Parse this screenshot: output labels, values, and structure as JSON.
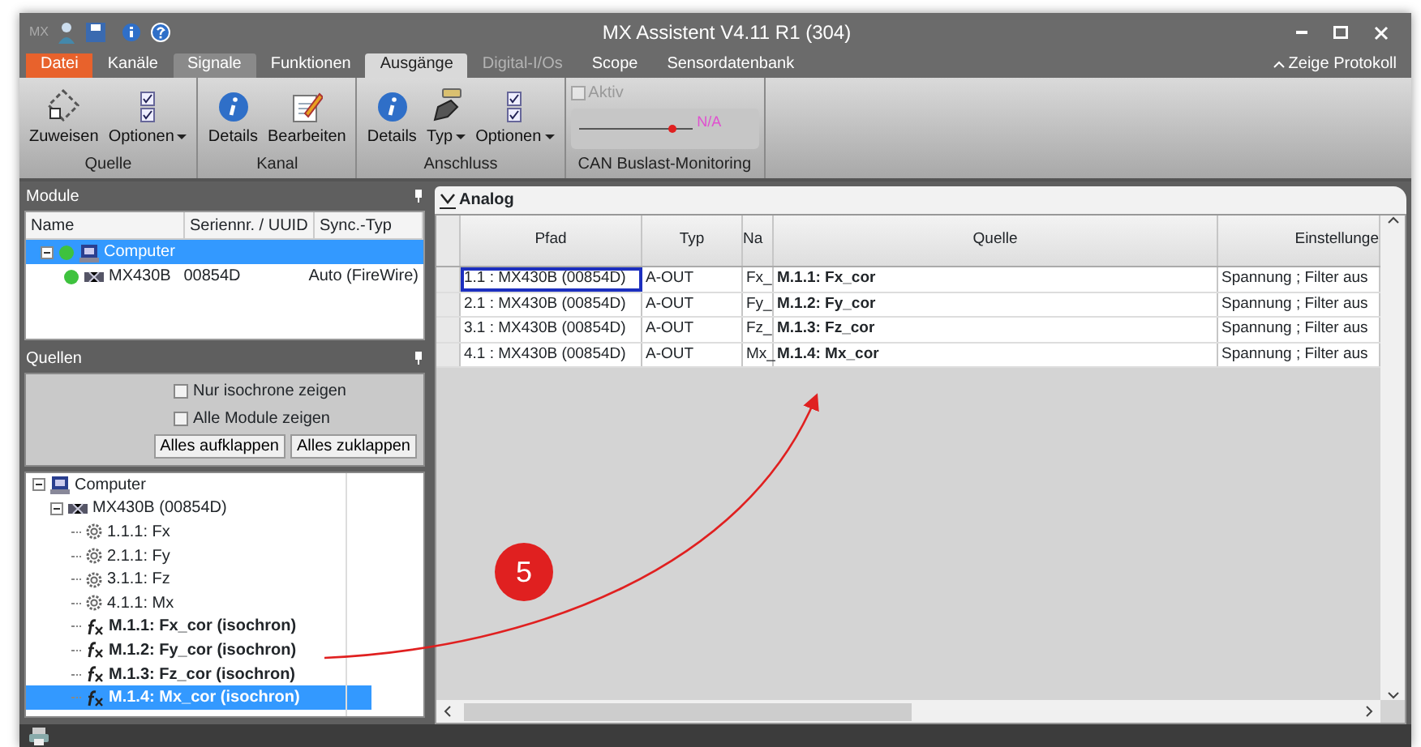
{
  "window": {
    "title": "MX Assistent V4.11 R1 (304)",
    "app_mark": "MX"
  },
  "ribbon_tabs": [
    {
      "label": "Datei",
      "kind": "file",
      "selected": false,
      "disabled": false
    },
    {
      "label": "Kanäle",
      "kind": "tab",
      "selected": false,
      "disabled": false
    },
    {
      "label": "Signale",
      "kind": "tab",
      "selected": false,
      "disabled": false,
      "hover": true
    },
    {
      "label": "Funktionen",
      "kind": "tab",
      "selected": false,
      "disabled": false
    },
    {
      "label": "Ausgänge",
      "kind": "tab",
      "selected": true,
      "disabled": false
    },
    {
      "label": "Digital-I/Os",
      "kind": "tab",
      "selected": false,
      "disabled": true
    },
    {
      "label": "Scope",
      "kind": "tab",
      "selected": false,
      "disabled": false
    },
    {
      "label": "Sensordatenbank",
      "kind": "tab",
      "selected": false,
      "disabled": false
    }
  ],
  "protocol_toggle": {
    "label": "Zeige Protokoll"
  },
  "ribbon_groups": [
    {
      "label": "Quelle",
      "buttons": [
        {
          "label": "Zuweisen",
          "kind": "assign",
          "dropdown": false
        },
        {
          "label": "Optionen",
          "kind": "options",
          "dropdown": true
        }
      ]
    },
    {
      "label": "Kanal",
      "buttons": [
        {
          "label": "Details",
          "kind": "info",
          "dropdown": false
        },
        {
          "label": "Bearbeiten",
          "kind": "edit",
          "dropdown": false
        }
      ]
    },
    {
      "label": "Anschluss",
      "buttons": [
        {
          "label": "Details",
          "kind": "info",
          "dropdown": false
        },
        {
          "label": "Typ",
          "kind": "plug",
          "dropdown": true
        },
        {
          "label": "Optionen",
          "kind": "options",
          "dropdown": true
        }
      ]
    }
  ],
  "can_group": {
    "label": "CAN Buslast-Monitoring",
    "checkbox": {
      "label": "Aktiv",
      "checked": false,
      "disabled": true
    },
    "meter": {
      "reading": "N/A",
      "level": 0.82
    }
  },
  "modules": {
    "title": "Module",
    "columns": [
      "Name",
      "Seriennr. / UUID",
      "Sync.-Typ"
    ],
    "rows": [
      {
        "name": "Computer",
        "kind": "computer",
        "selected": true,
        "serial": "",
        "sync": "",
        "children": [
          {
            "name": "MX430B",
            "kind": "module",
            "selected": false,
            "serial": "00854D",
            "sync": "Auto (FireWire)"
          }
        ]
      }
    ]
  },
  "sources": {
    "title": "Quellen",
    "options": [
      {
        "label": "Nur isochrone zeigen",
        "checked": false
      },
      {
        "label": "Alle Module zeigen",
        "checked": false
      }
    ],
    "buttons": [
      "Alles aufklappen",
      "Alles zuklappen"
    ],
    "tree": [
      {
        "label": "Computer",
        "kind": "computer",
        "selected": false,
        "children": [
          {
            "label": "MX430B (00854D)",
            "kind": "module",
            "selected": false,
            "children": [
              {
                "label": "1.1.1: Fx",
                "kind": "channel",
                "selected": false
              },
              {
                "label": "2.1.1: Fy",
                "kind": "channel",
                "selected": false
              },
              {
                "label": "3.1.1: Fz",
                "kind": "channel",
                "selected": false
              },
              {
                "label": "4.1.1: Mx",
                "kind": "channel",
                "selected": false
              },
              {
                "label": "M.1.1: Fx_cor (isochron)",
                "kind": "function",
                "selected": false
              },
              {
                "label": "M.1.2: Fy_cor (isochron)",
                "kind": "function",
                "selected": false
              },
              {
                "label": "M.1.3: Fz_cor (isochron)",
                "kind": "function",
                "selected": false
              },
              {
                "label": "M.1.4: Mx_cor (isochron)",
                "kind": "function",
                "selected": true
              }
            ]
          }
        ]
      }
    ]
  },
  "outputs": {
    "tab": "Analog",
    "columns": [
      "Pfad",
      "Typ",
      "Na",
      "Quelle",
      "Einstellunge"
    ],
    "rows": [
      {
        "path": "1.1 : MX430B (00854D)",
        "type": "A-OUT",
        "name": "Fx_",
        "source": "M.1.1: Fx_cor",
        "settings": "Spannung ; Filter aus",
        "focused": true
      },
      {
        "path": "2.1 : MX430B (00854D)",
        "type": "A-OUT",
        "name": "Fy_",
        "source": "M.1.2: Fy_cor",
        "settings": "Spannung ; Filter aus",
        "focused": false
      },
      {
        "path": "3.1 : MX430B (00854D)",
        "type": "A-OUT",
        "name": "Fz_",
        "source": "M.1.3: Fz_cor",
        "settings": "Spannung ; Filter aus",
        "focused": false
      },
      {
        "path": "4.1 : MX430B (00854D)",
        "type": "A-OUT",
        "name": "Mx_",
        "source": "M.1.4: Mx_cor",
        "settings": "Spannung ; Filter aus",
        "focused": false
      }
    ]
  },
  "annotation": {
    "label": "5"
  }
}
